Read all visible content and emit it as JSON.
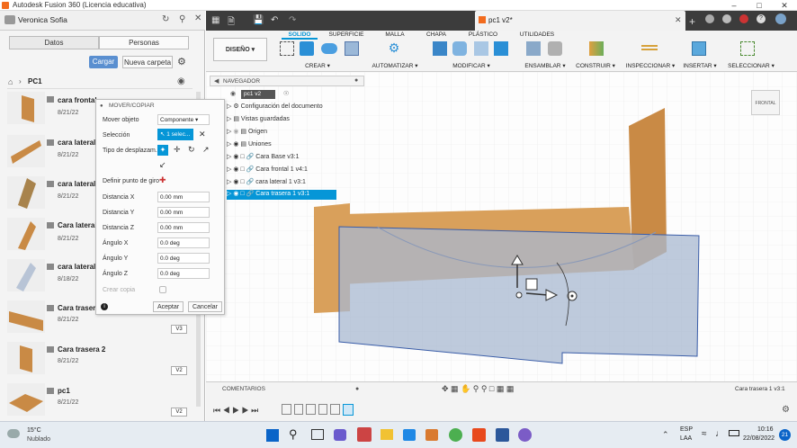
{
  "window": {
    "title": "Autodesk Fusion 360 (Licencia educativa)",
    "document_tab": "pc1 v2*"
  },
  "data_panel": {
    "user": "Veronica Sofia",
    "tabs": [
      "Datos",
      "Personas"
    ],
    "buttons": {
      "upload": "Cargar",
      "new_folder": "Nueva carpeta"
    },
    "breadcrumb": "PC1",
    "items": [
      {
        "name": "cara frontal",
        "date": "8/21/22",
        "version": ""
      },
      {
        "name": "cara lateral",
        "date": "8/21/22",
        "version": ""
      },
      {
        "name": "cara lateral",
        "date": "8/21/22",
        "version": ""
      },
      {
        "name": "Cara lateral",
        "date": "8/21/22",
        "version": ""
      },
      {
        "name": "cara lateral",
        "date": "8/18/22",
        "version": ""
      },
      {
        "name": "Cara trasera",
        "date": "8/21/22",
        "version": "V3"
      },
      {
        "name": "Cara trasera 2",
        "date": "8/21/22",
        "version": "V2"
      },
      {
        "name": "pc1",
        "date": "8/21/22",
        "version": "V2"
      }
    ]
  },
  "toolbar": {
    "workspace": "DISEÑO",
    "tabs": [
      "SOLIDO",
      "SUPERFICIE",
      "MALLA",
      "CHAPA",
      "PLÁSTICO",
      "UTILIDADES"
    ],
    "groups": [
      "CREAR",
      "AUTOMATIZAR",
      "MODIFICAR",
      "ENSAMBLAR",
      "CONSTRUIR",
      "INSPECCIONAR",
      "INSERTAR",
      "SELECCIONAR"
    ]
  },
  "navigator": {
    "title": "NAVEGADOR",
    "root": "pc1 v2",
    "rows": [
      "Configuración del documento",
      "Vistas guardadas",
      "Origen",
      "Uniones",
      "Cara Base v3:1",
      "Cara frontal 1 v4:1",
      "cara lateral 1 v3:1",
      "Cara trasera 1 v3:1"
    ]
  },
  "move_dialog": {
    "title": "MOVER/COPIAR",
    "move_object_label": "Mover objeto",
    "move_object_value": "Componente",
    "selection_label": "Selección",
    "selection_value": "1 selec...",
    "move_type_label": "Tipo de desplazam...",
    "pivot_label": "Definir punto de giro",
    "fields": [
      {
        "label": "Distancia X",
        "value": "0.00 mm"
      },
      {
        "label": "Distancia Y",
        "value": "0.00 mm"
      },
      {
        "label": "Distancia Z",
        "value": "0.00 mm"
      },
      {
        "label": "Ángulo X",
        "value": "0.0 deg"
      },
      {
        "label": "Ángulo Y",
        "value": "0.0 deg"
      },
      {
        "label": "Ángulo Z",
        "value": "0.0 deg"
      }
    ],
    "create_copy_label": "Crear copia",
    "ok": "Aceptar",
    "cancel": "Cancelar"
  },
  "viewcube": "FRONTAL",
  "comments": {
    "label": "COMENTARIOS",
    "status": "Cara trasera 1 v3:1"
  },
  "taskbar": {
    "weather_temp": "15°C",
    "weather_desc": "Nublado",
    "lang": "ESP",
    "lang2": "LAA",
    "time": "10:16",
    "date": "22/08/2022",
    "notif": "21"
  },
  "colors": {
    "accent": "#0696d7",
    "wood": "#d9a05b",
    "selected_part": "#a8b8d0"
  }
}
